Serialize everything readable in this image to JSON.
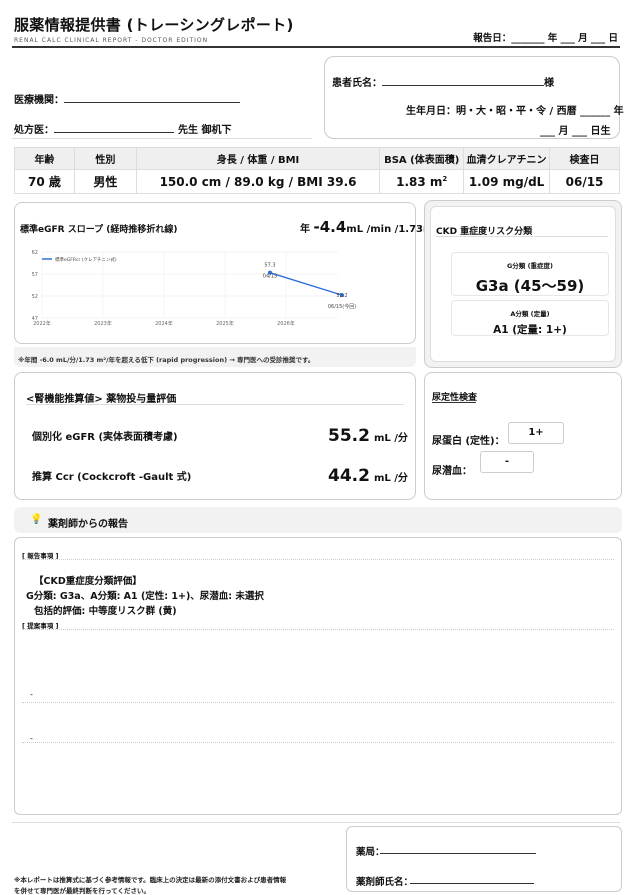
{
  "header": {
    "title": "服薬情報提供書 (トレーシングレポート)",
    "subtitle": "RENAL CALC CLINICAL REPORT - DOCTOR EDITION",
    "report_date": "報告日：_______ 年 ___ 月 ___ 日"
  },
  "patient": {
    "name_label": "患者氏名：",
    "name_suffix": "様",
    "dob_label": "生年月日：明・大・昭・平・令 / 西暦 ______ 年",
    "dob_line2": "___ 月 ___ 日生"
  },
  "institution": {
    "label": "医療機関：",
    "doctor_label": "処方医：",
    "doctor_suffix": "先生 御机下"
  },
  "vitals": {
    "headers": [
      "年齢",
      "性別",
      "身長 / 体重 / BMI",
      "BSA (体表面積)",
      "血清クレアチニン",
      "検査日"
    ],
    "age": "70 歳",
    "sex": "男性",
    "body": "150.0 cm / 89.0 kg / BMI 39.6",
    "bsa_value": "1.83 m",
    "bsa_sup": "2",
    "creatinine": "1.09 mg/dL",
    "test_date": "06/15"
  },
  "egfr_panel": {
    "title": "標準eGFR スロープ (経時推移折れ線)",
    "slope_prefix": "年",
    "slope_value": "-4.4",
    "slope_unit": "mL /min /1.73m",
    "slope_unit_sup": "2",
    "progression_note": "※年間 -6.0 mL/分/1.73 m²/年を超える低下 (rapid progression) → 専門医への受診推奨です。"
  },
  "chart_data": {
    "type": "line",
    "series": [
      {
        "name": "標準eGFRcr (クレアチニン式)",
        "x": [
          "2025-04-15",
          "2026-06-15"
        ],
        "y": [
          57.3,
          52.2
        ],
        "point_labels": [
          "57.3\n04/15",
          "52.2\n06/15(今回)"
        ]
      }
    ],
    "x_ticks": [
      "2022年",
      "2023年",
      "2024年",
      "2025年",
      "2026年"
    ],
    "y_ticks": [
      47,
      52,
      57,
      62
    ],
    "ylim": [
      47,
      62
    ],
    "grid": true,
    "legend": "top-left",
    "color": "#2e6fd9"
  },
  "ckd": {
    "title": "CKD 重症度リスク分類",
    "g_label": "G分類 (重症度)",
    "g_value": "G3a  (45〜59)",
    "a_label": "A分類 (定量)",
    "a_value": "A1  (定量: 1+)"
  },
  "dose": {
    "title": "<腎機能推算値> 薬物投与量評価",
    "egfr_label": "個別化 eGFR  (実体表面積考慮)",
    "egfr_value": "55.2",
    "egfr_unit": "mL /分",
    "ccr_label": "推算 Ccr  (Cockcroft -Gault 式)",
    "ccr_value": "44.2",
    "ccr_unit": "mL /分"
  },
  "urine": {
    "title": "尿定性検査",
    "protein_label": "尿蛋白 (定性)：",
    "protein_value": "1+",
    "blood_label": "尿潜血：",
    "blood_value": "-"
  },
  "pharmacist": {
    "title": "薬剤師からの報告",
    "report_items_label": "[ 報告事項 ]",
    "line1": "【CKD重症度分類評価】",
    "line2": "G分類: G3a、A分類: A1 (定性: 1+)、尿潜血: 未選択",
    "line3": "包括的評価: 中等度リスク群 (黄)",
    "proposal_label": "[ 提案事項 ]",
    "dot": "-"
  },
  "footer": {
    "note1": "※本レポートは推算式に基づく参考情報です。臨床上の決定は最新の添付文書および患者情報",
    "note2": "を併せて専門医が最終判断を行ってください。",
    "pharmacy_label": "薬局：",
    "pharmacist_label": "薬剤師氏名："
  }
}
